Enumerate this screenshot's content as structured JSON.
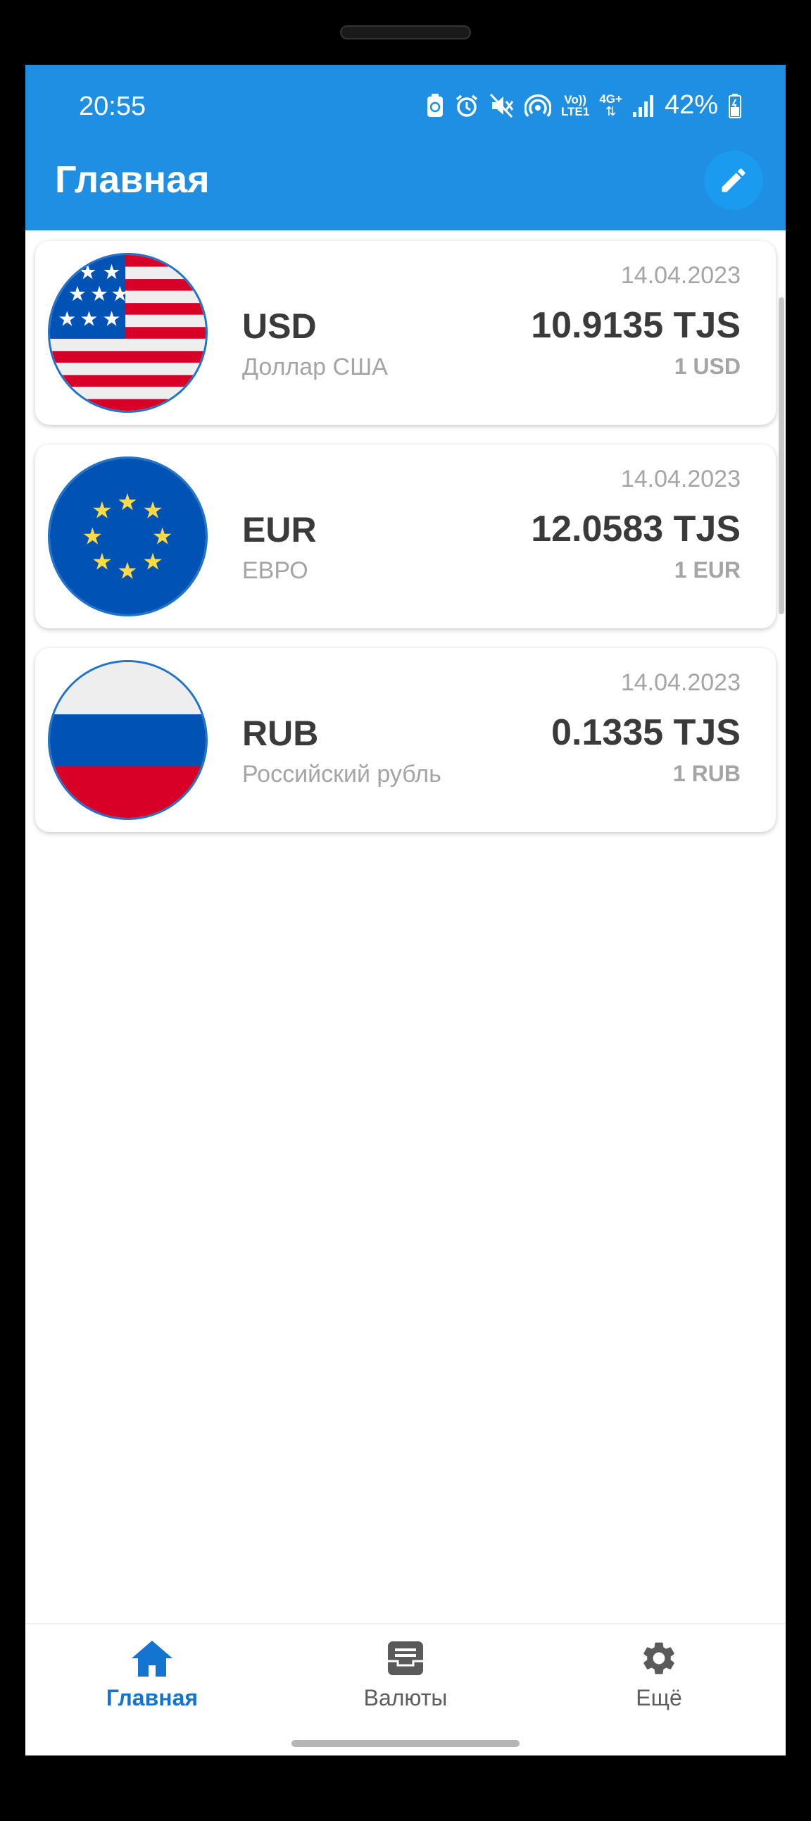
{
  "status_bar": {
    "time": "20:55",
    "battery_percent": "42%",
    "icons": [
      "battery-saver-icon",
      "alarm-icon",
      "mute-icon",
      "hotspot-icon",
      "volte-icon",
      "4g-data-icon",
      "signal-icon",
      "battery-icon"
    ],
    "volte_label_top": "Vo))",
    "volte_label_bottom": "LTE1",
    "network_label": "4G+"
  },
  "app_bar": {
    "title": "Главная",
    "edit_icon": "pencil-icon"
  },
  "colors": {
    "primary": "#1e8fe2",
    "active_nav": "#1475d0",
    "text_dark": "#3a3a3a",
    "text_muted": "#a5a5a5"
  },
  "currencies": [
    {
      "flag": "us-flag",
      "code": "USD",
      "name": "Доллар США",
      "date": "14.04.2023",
      "rate": "10.9135 TJS",
      "unit": "1 USD"
    },
    {
      "flag": "eu-flag",
      "code": "EUR",
      "name": "ЕВРО",
      "date": "14.04.2023",
      "rate": "12.0583 TJS",
      "unit": "1 EUR"
    },
    {
      "flag": "ru-flag",
      "code": "RUB",
      "name": "Российский рубль",
      "date": "14.04.2023",
      "rate": "0.1335 TJS",
      "unit": "1 RUB"
    }
  ],
  "bottom_nav": [
    {
      "label": "Главная",
      "icon": "home-icon",
      "active": true
    },
    {
      "label": "Валюты",
      "icon": "inbox-icon",
      "active": false
    },
    {
      "label": "Ещё",
      "icon": "gear-icon",
      "active": false
    }
  ]
}
